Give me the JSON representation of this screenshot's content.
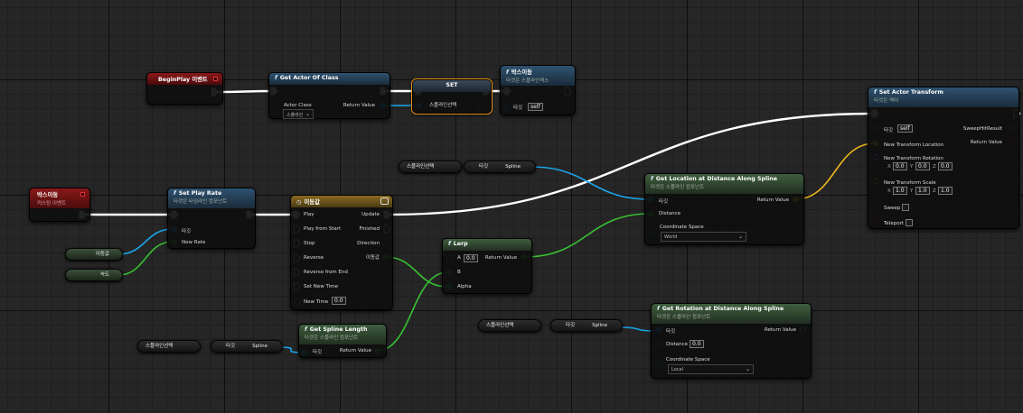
{
  "graph": {
    "colors": {
      "exec_wire": "#ffffff",
      "object_wire": "#1aa4e8",
      "float_wire": "#37c233",
      "vector_wire": "#f0b81b",
      "event_header": "#8a1818",
      "function_header": "#2f5270",
      "pure_header": "#3e5e3e",
      "timeline_header": "#8a6a20",
      "selection": "#e39016"
    },
    "icons": {
      "function": "f-function-icon",
      "exec_pin": "triangle-exec-pin",
      "data_pin": "circle-pin"
    }
  },
  "nodes": {
    "beginplay": {
      "title": "BeginPlay 이벤트"
    },
    "getactor": {
      "title": "Get Actor Of Class",
      "actor_class_label": "Actor Class",
      "actor_class_value": "스플라인",
      "return_label": "Return Value"
    },
    "set": {
      "title": "SET",
      "pin_label": "스플라인선택"
    },
    "boxmove_call": {
      "title": "박스이동",
      "subtitle": "타겟은 스플라인액스",
      "target_label": "타깃",
      "target_value": "self"
    },
    "boxmove_event": {
      "title": "박스이동",
      "subtitle": "커스텀 이벤트"
    },
    "setplayrate": {
      "title": "Set Play Rate",
      "subtitle": "타겟은 타임라인 컴포넌트",
      "target_label": "타깃",
      "rate_label": "New Rate"
    },
    "timeline": {
      "title": "이동값",
      "inputs": [
        "Play",
        "Play from Start",
        "Stop",
        "Reverse",
        "Reverse from End",
        "Set New Time",
        "New Time"
      ],
      "new_time_value": "0.0",
      "outputs": [
        "Update",
        "Finished",
        "Direction",
        "이동값"
      ]
    },
    "var_move": {
      "label": "이동값"
    },
    "var_speed": {
      "label": "속도"
    },
    "lerp": {
      "title": "Lerp",
      "a_label": "A",
      "a_value": "0.0",
      "b_label": "B",
      "alpha_label": "Alpha",
      "return_label": "Return Value"
    },
    "getlength": {
      "title": "Get Spline Length",
      "subtitle": "타겟은 스플라인 컴포넌트",
      "target_label": "타깃",
      "return_label": "Return Value"
    },
    "getloc": {
      "title": "Get Location at Distance Along Spline",
      "subtitle": "타겟은 스플라인 컴포넌트",
      "target_label": "타깃",
      "distance_label": "Distance",
      "return_label": "Return Value",
      "coord_label": "Coordinate Space",
      "coord_value": "World"
    },
    "getrot": {
      "title": "Get Rotation at Distance Along Spline",
      "subtitle": "타겟은 스플라인 컴포넌트",
      "target_label": "타깃",
      "return_label": "Return Value",
      "distance_label": "Distance",
      "distance_value": "0.0",
      "coord_label": "Coordinate Space",
      "coord_value": "Local"
    },
    "settransform": {
      "title": "Set Actor Transform",
      "subtitle": "타겟은 액터",
      "target_label": "타깃",
      "target_value": "self",
      "sweep_hit_label": "SweepHitResult",
      "return_label": "Return Value",
      "location_label": "New Transform Location",
      "rotation_label": "New Transform Rotation",
      "rotation": {
        "x": "0.0",
        "y": "0.0",
        "z": "0.0"
      },
      "scale_label": "New Transform Scale",
      "scale": {
        "x": "1.0",
        "y": "1.0",
        "z": "1.0"
      },
      "sweep_label": "Sweep",
      "teleport_label": "Teleport"
    },
    "var_spline1": {
      "var": "스플라인선택",
      "target": "타깃",
      "out": "Spline"
    },
    "var_spline2": {
      "var": "스플라인선택",
      "target": "타깃",
      "out": "Spline"
    },
    "var_spline3": {
      "var": "스플라인선택",
      "target": "타깃",
      "out": "Spline"
    }
  }
}
